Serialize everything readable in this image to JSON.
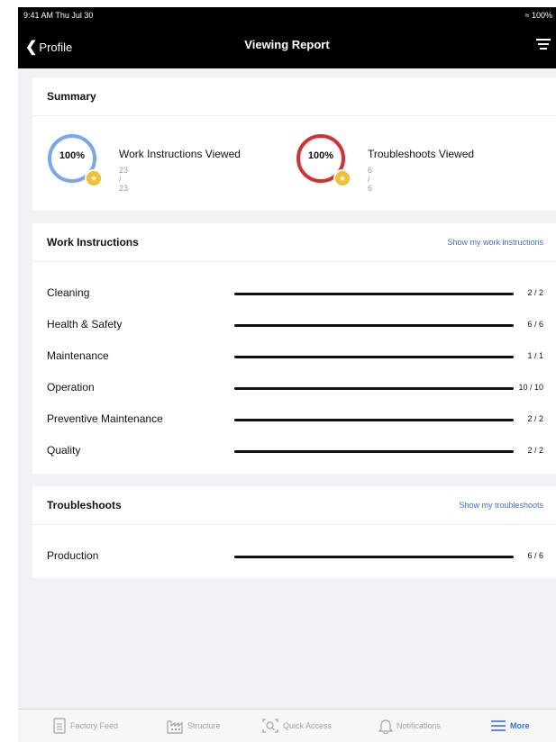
{
  "status": {
    "time": "9:41 AM   Thu Jul 30",
    "battery": "100%"
  },
  "nav": {
    "back_label": "Profile",
    "title": "Viewing Report"
  },
  "summary": {
    "title": "Summary",
    "items": [
      {
        "percent": "100%",
        "title": "Work Instructions Viewed",
        "count": "23 / 23",
        "fraction": 1.0,
        "ring_color": "#7aa6f0"
      },
      {
        "percent": "100%",
        "title": "Troubleshoots Viewed",
        "count": "6 / 6",
        "fraction": 1.0,
        "ring_color": "#d23232"
      }
    ]
  },
  "work_instructions": {
    "title": "Work Instructions",
    "link": "Show my work instructions",
    "rows": [
      {
        "label": "Cleaning",
        "value": "2 / 2",
        "fraction": 1.0
      },
      {
        "label": "Health & Safety",
        "value": "6 / 6",
        "fraction": 1.0
      },
      {
        "label": "Maintenance",
        "value": "1 / 1",
        "fraction": 1.0
      },
      {
        "label": "Operation",
        "value": "10 / 10",
        "fraction": 1.0
      },
      {
        "label": "Preventive Maintenance",
        "value": "2 / 2",
        "fraction": 1.0
      },
      {
        "label": "Quality",
        "value": "2 / 2",
        "fraction": 1.0
      }
    ]
  },
  "troubleshoots": {
    "title": "Troubleshoots",
    "link": "Show my troubleshoots",
    "rows": [
      {
        "label": "Production",
        "value": "6 / 6",
        "fraction": 1.0
      }
    ]
  },
  "tabs": {
    "factory_feed": "Factory Feed",
    "structure": "Structure",
    "quick_access": "Quick Access",
    "notifications": "Notifications",
    "more": "More"
  },
  "colors": {
    "accent": "#3b6fd8",
    "badge": "#f0c23a"
  }
}
